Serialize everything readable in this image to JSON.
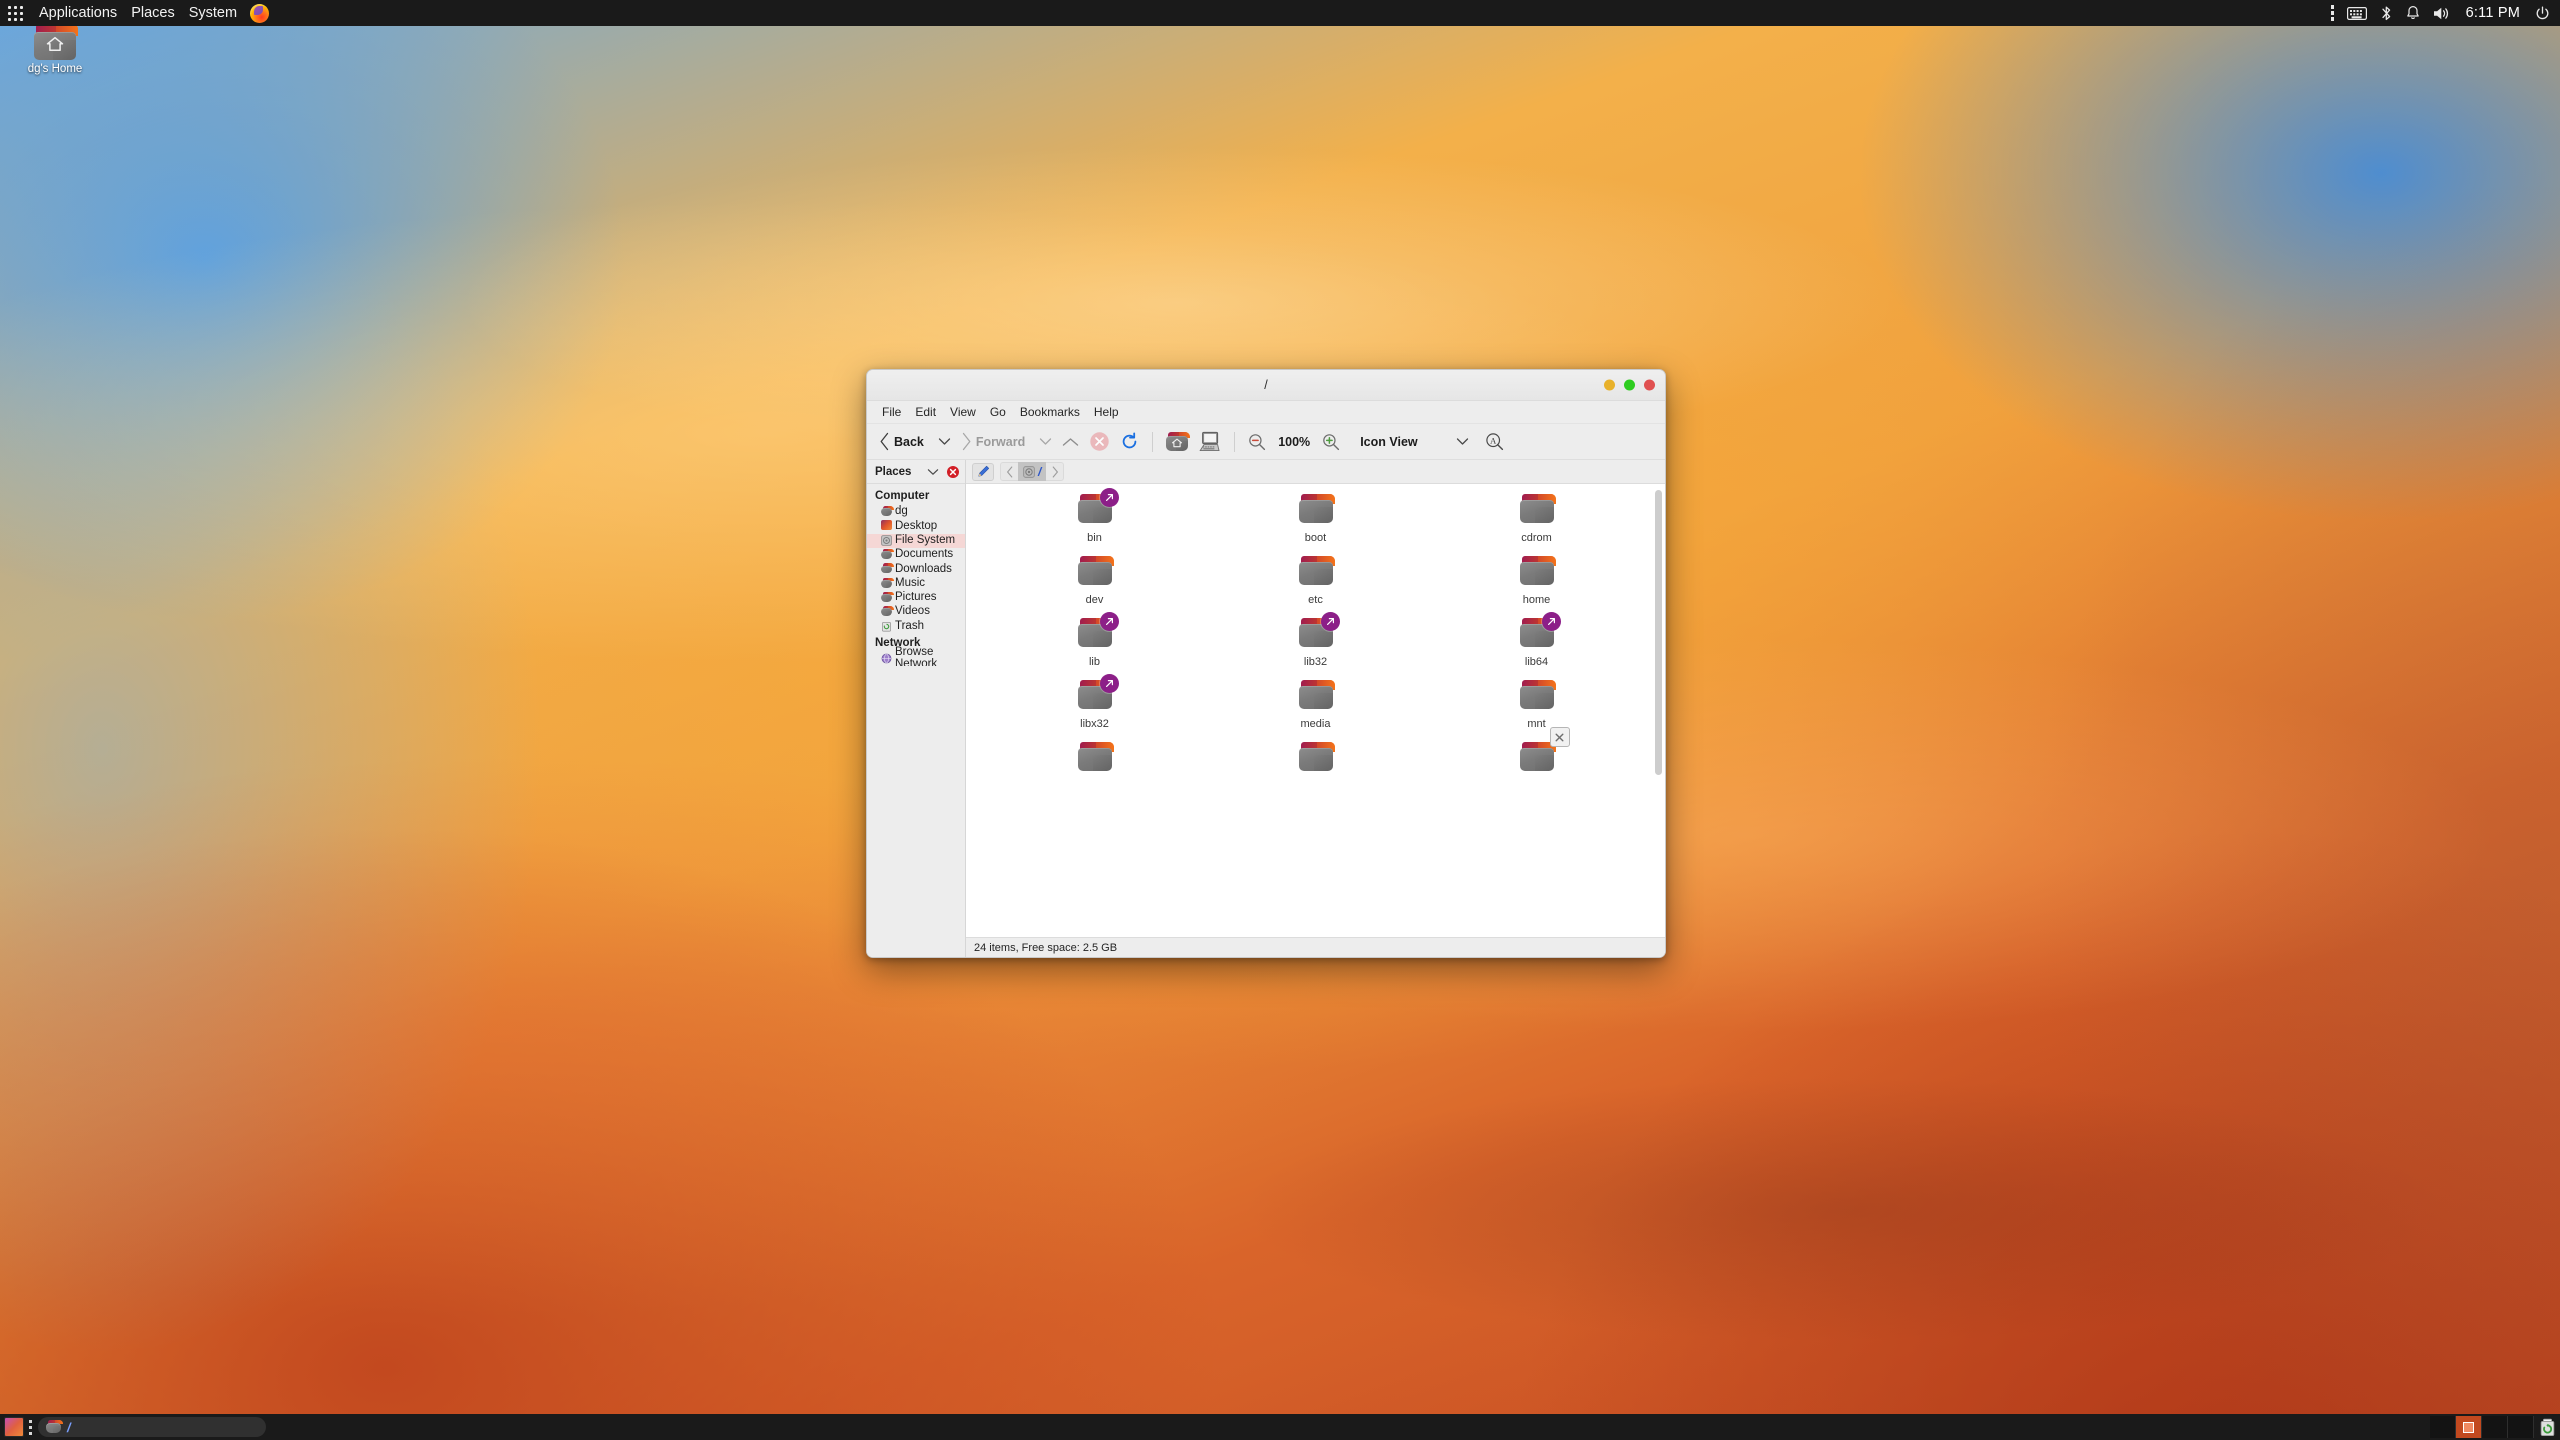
{
  "top_panel": {
    "apps_grid_icon": "grid-dots-icon",
    "menus": [
      "Applications",
      "Places",
      "System"
    ],
    "launcher_icon": "firefox-icon",
    "tray": {
      "overflow_icon": "vertical-dots-icon",
      "keyboard_icon": "keyboard-icon",
      "bluetooth_icon": "bluetooth-icon",
      "notifications_icon": "bell-icon",
      "volume_icon": "speaker-icon",
      "clock": "6:11 PM",
      "power_icon": "power-icon"
    }
  },
  "desktop": {
    "icons": [
      {
        "label": "dg's Home",
        "icon": "home-folder-icon"
      }
    ]
  },
  "file_manager": {
    "title": "/",
    "window_buttons": {
      "minimize": "minimize-button",
      "maximize": "maximize-button",
      "close": "close-button"
    },
    "menubar": [
      "File",
      "Edit",
      "View",
      "Go",
      "Bookmarks",
      "Help"
    ],
    "toolbar": {
      "back_label": "Back",
      "forward_label": "Forward",
      "up_icon": "chevron-up-icon",
      "stop_icon": "stop-icon",
      "reload_icon": "reload-icon",
      "home_icon": "home-folder-icon",
      "computer_icon": "computer-icon",
      "zoom_out_icon": "zoom-out-icon",
      "zoom_level": "100%",
      "zoom_in_icon": "zoom-in-icon",
      "view_mode": "Icon View",
      "search_icon": "search-icon"
    },
    "sidebar": {
      "title": "Places",
      "collapse_icon": "chevron-down-icon",
      "close_icon": "close-circle-icon",
      "groups": [
        {
          "name": "Computer",
          "items": [
            {
              "label": "dg",
              "icon": "home-folder-icon",
              "selected": false
            },
            {
              "label": "Desktop",
              "icon": "desktop-folder-icon",
              "selected": false
            },
            {
              "label": "File System",
              "icon": "filesystem-icon",
              "selected": true
            },
            {
              "label": "Documents",
              "icon": "documents-folder-icon",
              "selected": false
            },
            {
              "label": "Downloads",
              "icon": "downloads-folder-icon",
              "selected": false
            },
            {
              "label": "Music",
              "icon": "music-folder-icon",
              "selected": false
            },
            {
              "label": "Pictures",
              "icon": "pictures-folder-icon",
              "selected": false
            },
            {
              "label": "Videos",
              "icon": "videos-folder-icon",
              "selected": false
            },
            {
              "label": "Trash",
              "icon": "trash-icon",
              "selected": false
            }
          ]
        },
        {
          "name": "Network",
          "items": [
            {
              "label": "Browse Network",
              "icon": "network-globe-icon",
              "selected": false
            }
          ]
        }
      ]
    },
    "pathbar": {
      "edit_icon": "pencil-icon",
      "prev_icon": "chevron-left-icon",
      "next_icon": "chevron-right-icon",
      "current": "/",
      "current_icon": "filesystem-icon"
    },
    "files": [
      {
        "name": "bin",
        "type": "folder",
        "symlink": true,
        "partial": false
      },
      {
        "name": "boot",
        "type": "folder",
        "symlink": false,
        "partial": false
      },
      {
        "name": "cdrom",
        "type": "folder",
        "symlink": false,
        "partial": false
      },
      {
        "name": "dev",
        "type": "folder",
        "symlink": false,
        "partial": false
      },
      {
        "name": "etc",
        "type": "folder",
        "symlink": false,
        "partial": false
      },
      {
        "name": "home",
        "type": "folder",
        "symlink": false,
        "partial": false
      },
      {
        "name": "lib",
        "type": "folder",
        "symlink": true,
        "partial": false
      },
      {
        "name": "lib32",
        "type": "folder",
        "symlink": true,
        "partial": false
      },
      {
        "name": "lib64",
        "type": "folder",
        "symlink": true,
        "partial": false
      },
      {
        "name": "libx32",
        "type": "folder",
        "symlink": true,
        "partial": false
      },
      {
        "name": "media",
        "type": "folder",
        "symlink": false,
        "partial": false
      },
      {
        "name": "mnt",
        "type": "folder",
        "symlink": false,
        "partial": false
      },
      {
        "name": "",
        "type": "folder",
        "symlink": false,
        "partial": true
      },
      {
        "name": "",
        "type": "folder",
        "symlink": false,
        "partial": true
      },
      {
        "name": "",
        "type": "folder",
        "symlink": false,
        "partial": true,
        "x_badge": true
      }
    ],
    "statusbar": "24 items, Free space: 2.5 GB"
  },
  "bottom_panel": {
    "show_desktop_icon": "show-desktop-icon",
    "handle_icon": "drag-handle-icon",
    "task_button": {
      "label": "/",
      "icon": "folder-icon"
    },
    "workspaces": [
      {
        "active": false
      },
      {
        "active": true
      },
      {
        "active": false
      },
      {
        "active": false
      }
    ],
    "trash_icon": "trash-icon"
  },
  "colors": {
    "accent_orange": "#e95420",
    "panel_bg": "#1a1a1a",
    "selection_pink": "#f5d7d5",
    "symlink_purple": "#8c1f88",
    "window_min": "#e8b12a",
    "window_max": "#2ecc20",
    "window_close": "#e05050"
  }
}
